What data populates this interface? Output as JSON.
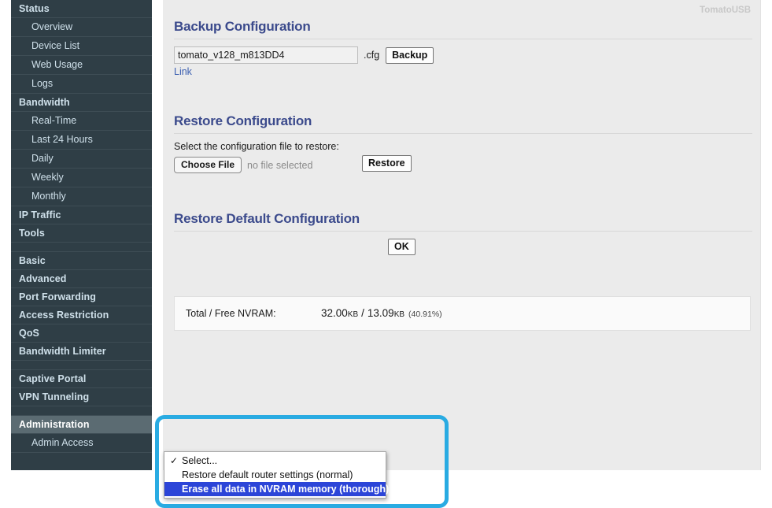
{
  "brand": "TomatoUSB",
  "sidebar": {
    "groups": [
      {
        "head": "Status",
        "active": false,
        "items": [
          "Overview",
          "Device List",
          "Web Usage",
          "Logs"
        ]
      },
      {
        "head": "Bandwidth",
        "active": false,
        "items": [
          "Real-Time",
          "Last 24 Hours",
          "Daily",
          "Weekly",
          "Monthly"
        ]
      },
      {
        "head": "IP Traffic",
        "active": false,
        "items": []
      },
      {
        "head": "Tools",
        "active": false,
        "items": []
      },
      {
        "head": "Basic",
        "active": false,
        "items": [],
        "spacer_before": true
      },
      {
        "head": "Advanced",
        "active": false,
        "items": []
      },
      {
        "head": "Port Forwarding",
        "active": false,
        "items": []
      },
      {
        "head": "Access Restriction",
        "active": false,
        "items": []
      },
      {
        "head": "QoS",
        "active": false,
        "items": []
      },
      {
        "head": "Bandwidth Limiter",
        "active": false,
        "items": []
      },
      {
        "head": "Captive Portal",
        "active": false,
        "items": [],
        "spacer_before": true
      },
      {
        "head": "VPN Tunneling",
        "active": false,
        "items": []
      },
      {
        "head": "Administration",
        "active": true,
        "items": [
          "Admin Access"
        ],
        "spacer_before": true
      }
    ]
  },
  "backup": {
    "title": "Backup Configuration",
    "filename_value": "tomato_v128_m813DD4",
    "filename_placeholder": "",
    "extension": ".cfg",
    "button_label": "Backup",
    "link_label": "Link"
  },
  "restore": {
    "title": "Restore Configuration",
    "instruction": "Select the configuration file to restore:",
    "choose_file_label": "Choose File",
    "no_file_text": "no file selected",
    "button_label": "Restore"
  },
  "restore_default": {
    "title": "Restore Default Configuration",
    "ok_label": "OK",
    "options": [
      {
        "label": "Select...",
        "checked": true,
        "selected": false
      },
      {
        "label": "Restore default router settings (normal)",
        "checked": false,
        "selected": false
      },
      {
        "label": "Erase all data in NVRAM memory (thorough)",
        "checked": false,
        "selected": true
      }
    ]
  },
  "nvram": {
    "label": "Total / Free NVRAM:",
    "total": "32.00",
    "total_unit": "KB",
    "separator": "/",
    "free": "13.09",
    "free_unit": "KB",
    "percent": "(40.91%)"
  },
  "colors": {
    "sidebar_bg": "#2f3e46",
    "sidebar_text": "#cfe0ea",
    "sidebar_active_bg": "#5b6b72",
    "content_bg": "#ebebeb",
    "heading": "#3b4a8c",
    "highlight_ring": "#29abe2",
    "dropdown_selected": "#2c45d8",
    "link": "#3b5fb0"
  }
}
